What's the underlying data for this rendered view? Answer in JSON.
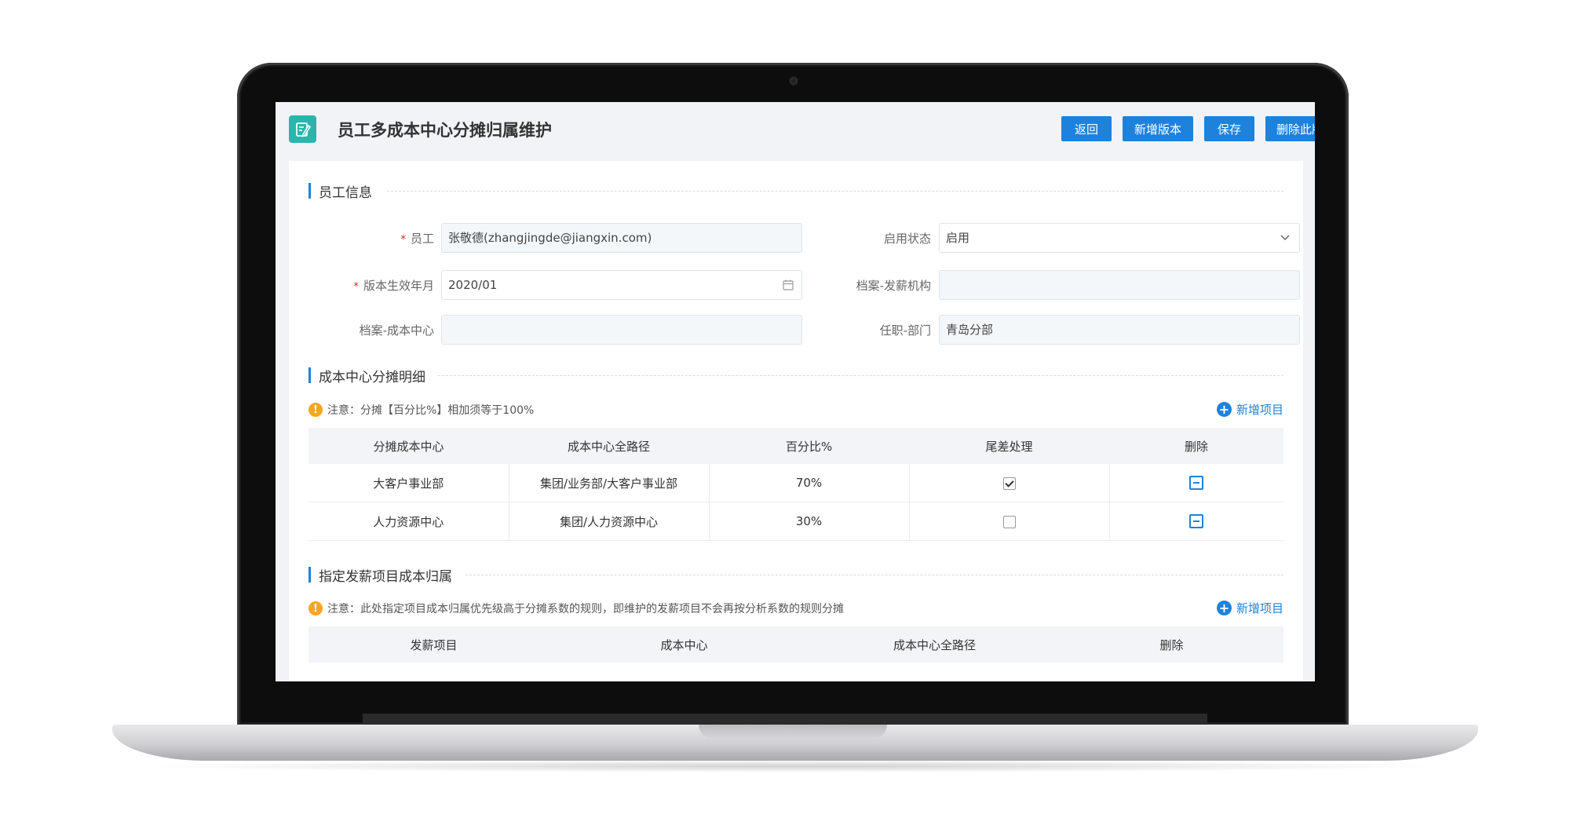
{
  "header": {
    "title": "员工多成本中心分摊归属维护",
    "buttons": {
      "back": "返回",
      "new_version": "新增版本",
      "save": "保存",
      "delete_version": "删除此版本"
    }
  },
  "employee_section": {
    "title": "员工信息",
    "fields": {
      "employee": {
        "label": "员工",
        "value": "张敬德(zhangjingde@jiangxin.com)"
      },
      "status": {
        "label": "启用状态",
        "value": "启用"
      },
      "effective_month": {
        "label": "版本生效年月",
        "value": "2020/01"
      },
      "pay_org": {
        "label": "档案-发薪机构",
        "value": ""
      },
      "cost_center": {
        "label": "档案-成本中心",
        "value": ""
      },
      "department": {
        "label": "任职-部门",
        "value": "青岛分部"
      }
    }
  },
  "allocation_section": {
    "title": "成本中心分摊明细",
    "notice": "注意：分摊【百分比%】相加须等于100%",
    "add_label": "新增项目",
    "columns": [
      "分摊成本中心",
      "成本中心全路径",
      "百分比%",
      "尾差处理",
      "删除"
    ],
    "rows": [
      {
        "center": "大客户事业部",
        "path": "集团/业务部/大客户事业部",
        "percent": "70%",
        "tail": true
      },
      {
        "center": "人力资源中心",
        "path": "集团/人力资源中心",
        "percent": "30%",
        "tail": false
      }
    ]
  },
  "pay_item_section": {
    "title": "指定发薪项目成本归属",
    "notice": "注意：此处指定项目成本归属优先级高于分摊系数的规则，即维护的发薪项目不会再按分析系数的规则分摊",
    "add_label": "新增项目",
    "columns": [
      "发薪项目",
      "成本中心",
      "成本中心全路径",
      "删除"
    ]
  },
  "colors": {
    "accent": "#1e82dc",
    "icon_bg": "#2bb5ad",
    "warning": "#f5a623"
  }
}
